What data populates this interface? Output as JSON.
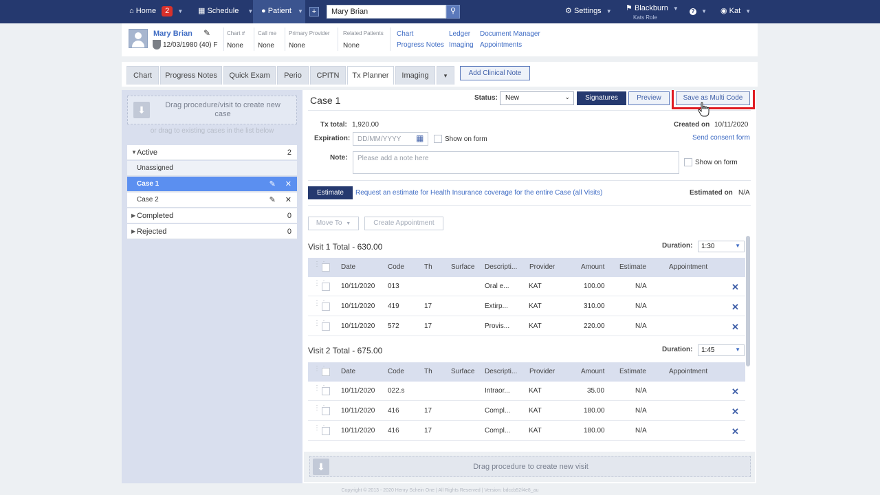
{
  "nav": {
    "home_label": "Home",
    "home_badge": "2",
    "schedule_label": "Schedule",
    "patient_label": "Patient",
    "plus_label": "+",
    "search_value": "Mary Brian",
    "settings_label": "Settings",
    "location_label": "Blackburn",
    "location_role": "Kats Role",
    "help_label": "?",
    "user_label": "Kat"
  },
  "patient": {
    "name": "Mary Brian",
    "dob": "12/03/1980 (40) F",
    "chart_num_label": "Chart #",
    "chart_num": "None",
    "call_me_label": "Call me",
    "call_me": "None",
    "provider_label": "Primary Provider",
    "provider": "None",
    "related_label": "Related Patients",
    "related": "None",
    "links": [
      "Chart",
      "Progress Notes",
      "Ledger",
      "Imaging",
      "Document Manager",
      "Appointments"
    ]
  },
  "tabs": [
    "Chart",
    "Progress Notes",
    "Quick Exam",
    "Perio",
    "CPITN",
    "Tx Planner",
    "Imaging"
  ],
  "tabs_more": "▾",
  "add_note_label": "Add Clinical Note",
  "sidebar": {
    "drop_text": "Drag procedure/visit to create new case",
    "drop_sub": "or drag to existing cases in the list below",
    "active_label": "Active",
    "active_count": "2",
    "unassigned_label": "Unassigned",
    "case1_label": "Case 1",
    "case2_label": "Case 2",
    "completed_label": "Completed",
    "completed_count": "0",
    "rejected_label": "Rejected",
    "rejected_count": "0"
  },
  "case": {
    "title": "Case 1",
    "status_label": "Status:",
    "status_value": "New",
    "signatures_label": "Signatures",
    "preview_label": "Preview",
    "multi_code_label": "Save as Multi Code",
    "tx_total_label": "Tx total:",
    "tx_total": "1,920.00",
    "created_label": "Created on",
    "created_value": "10/11/2020",
    "expiration_label": "Expiration:",
    "expiration_placeholder": "DD/MM/YYYY",
    "show_on_form": "Show on form",
    "consent_link": "Send consent form",
    "note_label": "Note:",
    "note_placeholder": "Please add a note here",
    "estimate_label": "Estimate",
    "estimate_text": "Request an estimate for Health Insurance coverage for the entire Case (all Visits)",
    "estimated_on_label": "Estimated on",
    "estimated_on_value": "N/A",
    "move_to_label": "Move To",
    "create_appt_label": "Create Appointment"
  },
  "columns": [
    "Date",
    "Code",
    "Th",
    "Surface",
    "Descripti...",
    "Provider",
    "Amount",
    "Estimate",
    "Appointment"
  ],
  "duration_label": "Duration:",
  "visits": [
    {
      "title": "Visit 1 Total - 630.00",
      "duration": "1:30",
      "rows": [
        {
          "date": "10/11/2020",
          "code": "013",
          "th": "",
          "surface": "",
          "desc": "Oral e...",
          "provider": "KAT",
          "amount": "100.00",
          "estimate": "N/A"
        },
        {
          "date": "10/11/2020",
          "code": "419",
          "th": "17",
          "surface": "",
          "desc": "Extirp...",
          "provider": "KAT",
          "amount": "310.00",
          "estimate": "N/A"
        },
        {
          "date": "10/11/2020",
          "code": "572",
          "th": "17",
          "surface": "",
          "desc": "Provis...",
          "provider": "KAT",
          "amount": "220.00",
          "estimate": "N/A"
        }
      ]
    },
    {
      "title": "Visit 2 Total - 675.00",
      "duration": "1:45",
      "rows": [
        {
          "date": "10/11/2020",
          "code": "022.s",
          "th": "",
          "surface": "",
          "desc": "Intraor...",
          "provider": "KAT",
          "amount": "35.00",
          "estimate": "N/A"
        },
        {
          "date": "10/11/2020",
          "code": "416",
          "th": "17",
          "surface": "",
          "desc": "Compl...",
          "provider": "KAT",
          "amount": "180.00",
          "estimate": "N/A"
        },
        {
          "date": "10/11/2020",
          "code": "416",
          "th": "17",
          "surface": "",
          "desc": "Compl...",
          "provider": "KAT",
          "amount": "180.00",
          "estimate": "N/A"
        }
      ]
    }
  ],
  "bottom_drop_text": "Drag procedure to create new visit",
  "footer": "Copyright © 2013 - 2020 Henry Schein One | All Rights Reserved | Version: bdccb52f4e8_au"
}
